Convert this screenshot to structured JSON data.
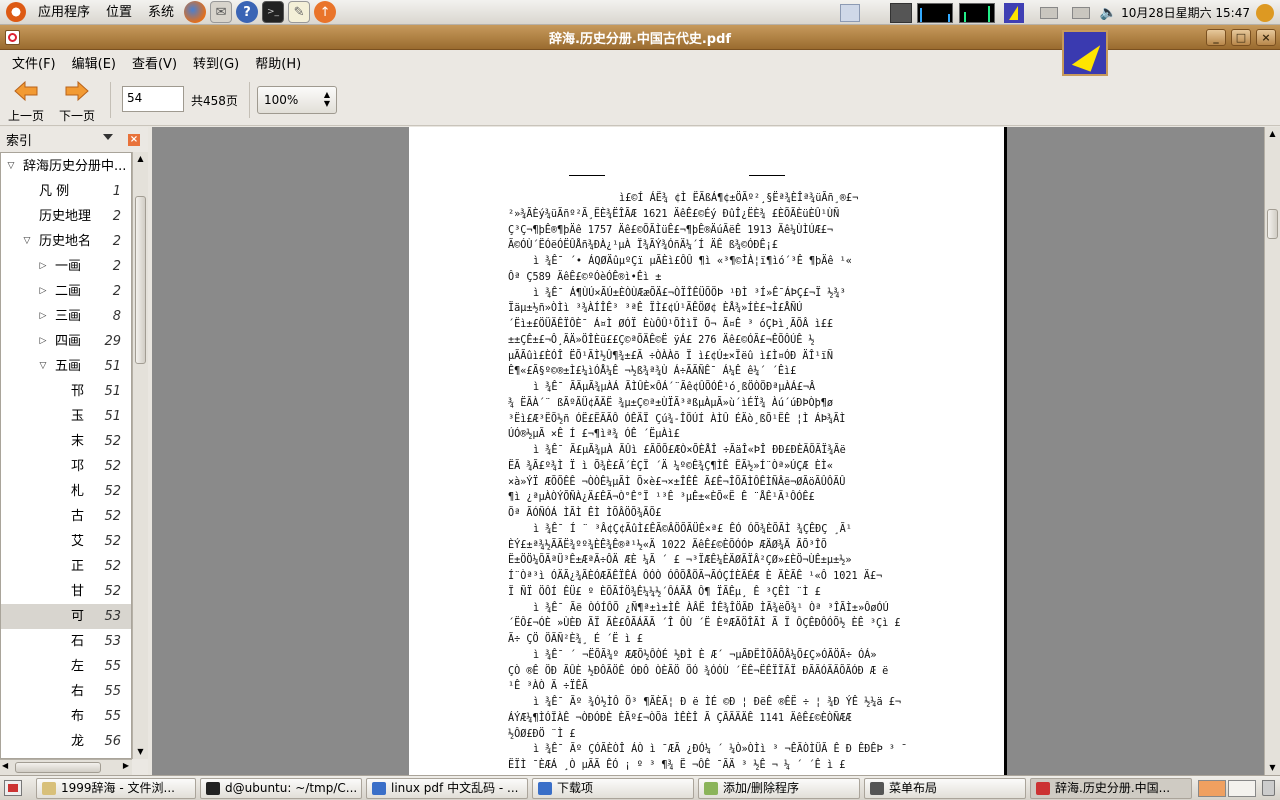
{
  "top_panel": {
    "menus": [
      "应用程序",
      "位置",
      "系统"
    ],
    "launchers": [
      "firefox-icon",
      "mail-icon",
      "help-icon",
      "terminal-icon",
      "text-editor-icon",
      "update-icon"
    ],
    "clock": "10月28日星期六 15:47"
  },
  "window": {
    "title": "辞海.历史分册.中国古代史.pdf"
  },
  "menubar": [
    "文件(F)",
    "编辑(E)",
    "查看(V)",
    "转到(G)",
    "帮助(H)"
  ],
  "toolbar": {
    "prev_label": "上一页",
    "next_label": "下一页",
    "page_value": "54",
    "total_label": "共458页",
    "zoom_value": "100%"
  },
  "sidebar": {
    "header": "索引",
    "tree": [
      {
        "label": "辞海历史分册中...",
        "page": "",
        "level": 0,
        "expanded": true
      },
      {
        "label": "凡 例",
        "page": "1",
        "level": 1
      },
      {
        "label": "历史地理",
        "page": "2",
        "level": 1
      },
      {
        "label": "历史地名",
        "page": "2",
        "level": 1,
        "expanded": true
      },
      {
        "label": "一画",
        "page": "2",
        "level": 2,
        "collapsed": true
      },
      {
        "label": "二画",
        "page": "2",
        "level": 2,
        "collapsed": true
      },
      {
        "label": "三画",
        "page": "8",
        "level": 2,
        "collapsed": true
      },
      {
        "label": "四画",
        "page": "29",
        "level": 2,
        "collapsed": true
      },
      {
        "label": "五画",
        "page": "51",
        "level": 2,
        "expanded": true
      },
      {
        "label": "邗",
        "page": "51",
        "level": 3
      },
      {
        "label": "玉",
        "page": "51",
        "level": 3
      },
      {
        "label": "末",
        "page": "52",
        "level": 3
      },
      {
        "label": "邛",
        "page": "52",
        "level": 3
      },
      {
        "label": "札",
        "page": "52",
        "level": 3
      },
      {
        "label": "古",
        "page": "52",
        "level": 3
      },
      {
        "label": "艾",
        "page": "52",
        "level": 3
      },
      {
        "label": "正",
        "page": "52",
        "level": 3
      },
      {
        "label": "甘",
        "page": "52",
        "level": 3
      },
      {
        "label": "可",
        "page": "53",
        "level": 3,
        "selected": true
      },
      {
        "label": "石",
        "page": "53",
        "level": 3
      },
      {
        "label": "左",
        "page": "55",
        "level": 3
      },
      {
        "label": "右",
        "page": "55",
        "level": 3
      },
      {
        "label": "布",
        "page": "55",
        "level": 3
      },
      {
        "label": "龙",
        "page": "56",
        "level": 3
      }
    ]
  },
  "document": {
    "lines": [
      "ì£©Í ÁË¾ ¢Ì ËÃßÁ¶¢±ÖÃº²¸§Ëª¾ÈÎ­ª¾üÃñ¸®£¬",
      "²»¾ÃÈý¾üÃñº²Ã¸ËÈ¾ËÎÃÆ 1621 ÄêÊ£©Éý ÐûÎ¿ËÈ¾ £ÈÕÃÈüÈÛ¹ÙÑ",
      "Ç³Ç¬¶þÊ®¶þÄê 1757 Äê£©ÕÃÌüÊ£¬¶þÊ®ÄúÃëÊ 1913 Äê¼ÙÌÚÆ£¬",
      "Ã©ÓÙ´ËÓëÓËÛÅñ¾ÐÀ¿¹µÀ Ï¾ÃÝ¾ÓñÄ¼´Í ÄÊ ß¾©ÓÐÊ¡£",
      "ì ¾Ê¯ ´• ÁQØÄûµºÇï µÃÈì£ÔÛ ¶ì «³¶©ÌÀ¦ï¶ìó´³Ê ¶þÄê ¹«",
      "Ôª Ç589 ÄêÊ£©ºÓèÓÊ®ì•Êì ±",
      "ì ¾Ê¯ Á¶ÙÚ×ÃÚ±ÈÒÙÆæÕÄ£¬ÒÏÎÊÜÕÖÞ ¹ÐÌ ³Í»Ê¯ÁÞÇ£¬Ï ½¾³",
      "Ïäµ±½ñ»ÒÌì ³¾ÀÍÎÊ³ ³ªÊ ÏÌ£¢Ú¹ÃÊÖØ¢ ÈÅ¾»ÍÈ£¬Ì£ÅÑÚ",
      "´Ëì±£ÖÜÄÊÏÔÈ¯ Á¤Ì ØÓÏ ÈùÔÛ¹ÕÌìÏ Õ¬ Ã¤Ê ³ óÇÞì¸ÃÕÂ ì££",
      "±±ÇÊ±£¬Ô¸ÃÄ»ÖÎÈü££Ç©ªÕÄÊ©Ë ÿÁ£ 276 Äê£©ÓÃ£¬ÊÕÔÚÊ ½",
      "µÃÃûì£ÈÓÎ ËÕ¹ÃÌ½Û¶¾±£Ã ÷ÒÀÀõ Ï ì£¢Ú±×Ïëû ì£Ì¤ÓÐ ÄÎ¹ïÑ",
      "Ê¶«£Ã§º©®±Ì£¼ìÓÅ¼Ê ¬½ß¾ª¾Ù Á÷ÃÃÑÊ¯ Á¼Ê ê¼´ ´Êì£",
      "ì ¾Ê¯ ÃÃµÃ¾µÀÁ ÃÌÛÈ×ÔÁ´¨Ãê¢ÛÕÓÊ¹ó¸ßÖÒÖÐªµÀÁ£¬Â",
      "¾ ËÃÀ´¨ ßÃºÃÜ¢ÃÄË ¾µ±Ç©ª±ÙÏÃ³ªßµÀµÃ»ù´ìÉÏ¾ Àú´úÐÞÒþ¶ø",
      "³Ëì£Æ³ËÕ½ñ ÓË£ËÃÃÔ ÓÊÄÏ Çú¾-ÎÖÚÍ ÀÌÛ ÉÄò¸ßÕ¹ËÊ ¦Ì ÁÞ¾ÃÌ",
      "ÚÓ®½µÃ ×Ê Í £¬¶ìª¾ ÓÊ ´ËµÀì£",
      "ì ¾Ê¯ Ã£µÃ¾µÀ ÃÛì £ÃÕÕ£ÆÒ×ÕÈÅÎ ÷ÃäÎ«ÞÎ ÐÐ£ÐÈÃÕÃÏ¾Ãë",
      "ËÃ ¾Ã£º¾Ì Ï ì Õ¾È£Ã´ÈÇÏ ´Ä ¼º©Ê¾Ç¶ÌÊ ËÃ½»Í¨Òª»ÚÇÆ ÈÌ«",
      "×à»ÝÏ ÆÕÕÊÊ ¬ÒÒÊ¼µÃÌ Õ×è£¬×±ÎÊÊ Ã£Ê¬ÎÕÃÌÔÊÌÑÂë¬ØÃöÃÛÔÃÛ",
      "¶ì ¿ªµÀÒÝÕÑÀ¿Ä£ÊÃ¬Ò°Ê°Ï ¹³Ê ³µÊ±«ÈÕ«Ë Ê ¨ÅÊ¹Ã¹ÔÓÊ£",
      "Õª ÃÓÑÓÁ ÌÃÌ ÊÌ ÌÕÂÖÕ¾ÃÕ£",
      "ì ¾Ê¯ Í ¨ ³Â¢Ç¢ÃûÌ£ÊÃ©ÂÖÕÃÜÊ×ª£ ÊÓ ÓÕ¾ÈÕÃÌ ¾ÇÊÐÇ ¸Ã¹",
      "ÈÝ£±ª¾½ÃÃË¾ºº¾ÈÊ¾Ê®ª¹½«Ä 1022 ÄêÊ£©ÈÕÓÓÞ ÆÄØ¾Ä ÃÕ³ÎÕ",
      "Ë±ÖÖ¼ÕÃªÜ³Ê±ÆªÃ÷ÔÄ ÆÈ ¼Ã ´ £ ¬³ÏÆÊ¼ÈÄØÃÏÂ²ÇØ»£ÈÖ¬ÙÊ±µ±½»",
      "Í¨Òª³ì ÓÄÃ¿¾ÃÈÓÆÃÊÏÊÁ ÔÓÒ ÓÔÕÅÖÃ¬ÃÓÇÍÈÃÉÆ È ÄÈÃÊ ¹«Ô 1021 Ä£¬",
      "Ï ÑÏ ÖÔÍ ÊÜ£ º ÈÕÃÍÖ¾Ê¼¼½´ÔÁÃÅ Ô¶ ÏÃÊµ¸ Ê ³ÇÊÌ ¨Ì £",
      "ì ¾Ê¯ Ãë ÒÓÍÔÕ ¿Ñ¶ª±ì±ÌÊ ÀÂË ÎÊ¾ÎÖÃÐ ÌÃ¾ëÕ¾¹ Òª ³ÎÃÌ±»ÔøÓÚ",
      "´ËÔ£¬ÓÈ »ÙÈÐ ÃÏ ÃÈ£ÔÃÁÃÃ ´Î ÔÙ ´Ë ÈºÆÃÖÎÃÌ Ã Ï ÔÇÊÐÔÓÕ½ ÈÊ ³Çì £",
      "Ã÷ ÇÖ ÖÃÑ²È¾¸ É ´Ë ì £",
      "ì ¾Ê¯ ´ ¬ËÕÃ¾º ÆÆÕ½ÔÒÉ ½ÐÌ È Æ´ ¬µÃÐËÌÕÃÕÂ¼Õ£Ç»ÓÃÖÃ÷ ÓÁ»",
      "ÇÒ ®Ê ÖÐ ÃÛÈ ½ÐÔÃÖÊ ÓÐÔ ÒÈÃÖ ÖÓ ¾ÓÓÙ ´ËÊ¬ËÊÏÏÃÏ ÐÃÃÓÃÃÕÃÓÐ Æ ë",
      "¹Ê ³ÀÒ Ä ÷ÏÊÃ",
      "ì ¾Ê¯ Ãº ¾Ó½ÌÔ Ö³ ¶ÃÈÃ¦ Ð ë ÌÉ ©Ð ¦ ÐëÊ ®ÊË ÷ ¦ ¾Ð ÝÊ ½¼ä £¬",
      "ÁÝÆ¼¶ÌÓÏÀÊ ¬ÒÐÓÐÈ ÈÃº£¬ÒÕä ÌÊÈÎ Ã ÇÃÃÄÄÊ 1141 ÄêÊ£©ÈÒÑÆÆ",
      "½ÔØ£ÐÖ ¨Ì £",
      "ì ¾Ê¯ Ãº ÇÓÃÈÒÎ ÁÒ ì ¯ÆÃ ¿ÐÓ¼ ´ ¼Ò»ÒÌì ³ ¬ÊÃÒÌÜÃ Ê Ð ÊÐÊÞ ³ ¯",
      "ËÏÌ ¯ÈÆÁ ¸Ò µÃÃ ÊÓ ¡ º ³ ¶¾ Ë ¬ÔÊ ¯ÃÄ ³ ½Ê ¬ ¼ ´ ´Ê ì £"
    ]
  },
  "taskbar": [
    {
      "label": "1999辞海 - 文件浏...",
      "icon": "folder-icon"
    },
    {
      "label": "d@ubuntu: ~/tmp/C...",
      "icon": "terminal-icon"
    },
    {
      "label": "linux pdf 中文乱码 - ...",
      "icon": "firefox-icon"
    },
    {
      "label": "下载项",
      "icon": "firefox-icon"
    },
    {
      "label": "添加/删除程序",
      "icon": "package-icon"
    },
    {
      "label": "菜单布局",
      "icon": "menu-editor-icon"
    },
    {
      "label": "辞海.历史分册.中国...",
      "icon": "pdf-icon",
      "active": true
    }
  ]
}
